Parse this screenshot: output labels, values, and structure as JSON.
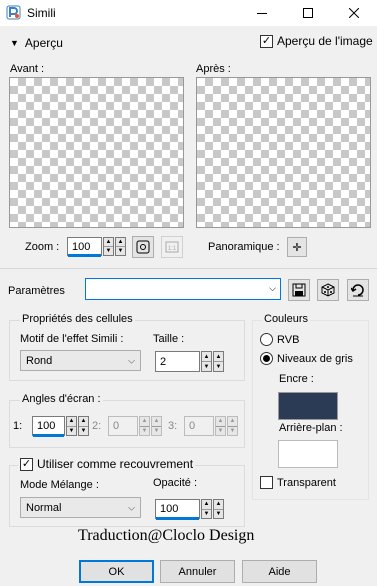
{
  "window": {
    "title": "Simili",
    "minimize_icon": "minimize-icon",
    "maximize_icon": "maximize-icon",
    "close_icon": "close-icon"
  },
  "preview_toggle": {
    "label": "Aperçu",
    "checkbox_label": "Aperçu de l'image",
    "checked": true
  },
  "before": {
    "label": "Avant :"
  },
  "after": {
    "label": "Après :"
  },
  "zoom": {
    "label": "Zoom :",
    "value": "100"
  },
  "pan": {
    "label": "Panoramique :"
  },
  "params": {
    "label": "Paramètres",
    "value": ""
  },
  "cell_props": {
    "title": "Propriétés des cellules",
    "pattern_label": "Motif de l'effet Simili :",
    "pattern_value": "Rond",
    "size_label": "Taille :",
    "size_value": "2"
  },
  "screen_angles": {
    "title": "Angles d'écran :",
    "a1_label": "1:",
    "a1_value": "100",
    "a2_label": "2:",
    "a2_value": "0",
    "a3_label": "3:",
    "a3_value": "0"
  },
  "overlay": {
    "checkbox_label": "Utiliser comme recouvrement",
    "checked": true,
    "blend_label": "Mode Mélange :",
    "blend_value": "Normal",
    "opacity_label": "Opacité :",
    "opacity_value": "100"
  },
  "colors": {
    "title": "Couleurs",
    "rgb_label": "RVB",
    "gray_label": "Niveaux de gris",
    "selected": "gray",
    "ink_label": "Encre :",
    "ink_color": "#2b3a55",
    "background_label": "Arrière-plan :",
    "background_color": "#ffffff",
    "transparent_label": "Transparent",
    "transparent_checked": false
  },
  "watermark": {
    "text": "Traduction@Cloclo Design"
  },
  "buttons": {
    "ok": "OK",
    "cancel": "Annuler",
    "help": "Aide"
  },
  "accent_color": "#0078d7"
}
